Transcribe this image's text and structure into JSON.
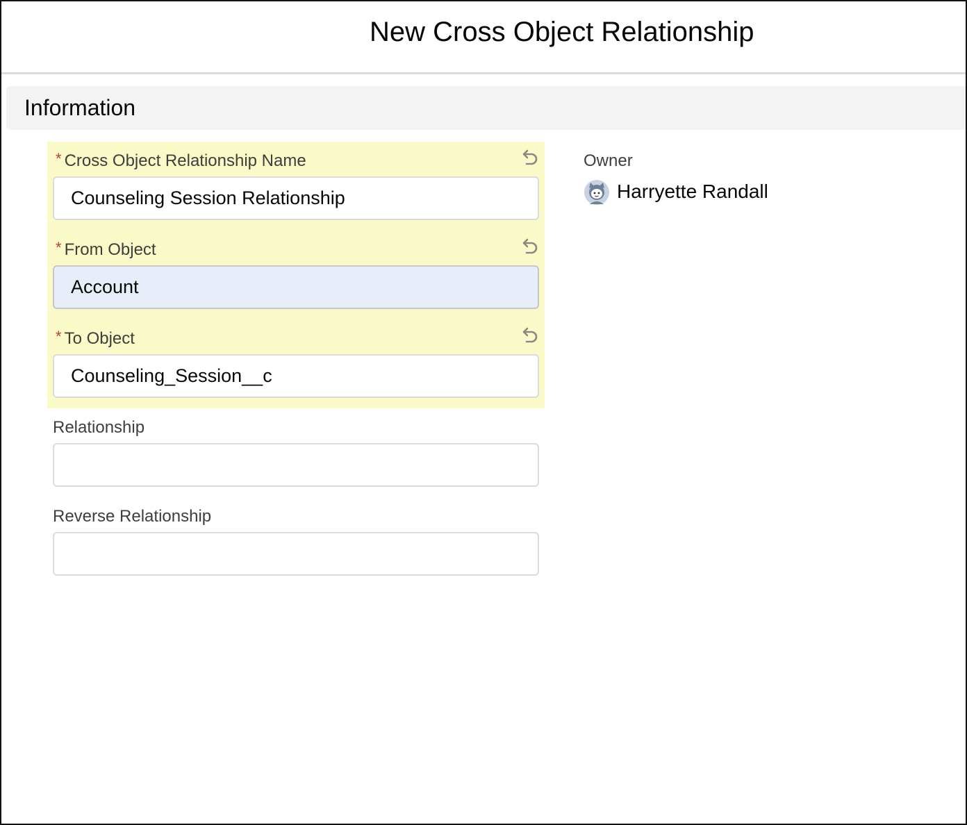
{
  "modal": {
    "title": "New Cross Object Relationship"
  },
  "section": {
    "title": "Information"
  },
  "fields": {
    "name": {
      "required_marker": "*",
      "label": "Cross Object Relationship Name",
      "value": "Counseling Session Relationship"
    },
    "from_object": {
      "required_marker": "*",
      "label": "From Object",
      "value": "Account"
    },
    "to_object": {
      "required_marker": "*",
      "label": "To Object",
      "value": "Counseling_Session__c"
    },
    "relationship": {
      "label": "Relationship",
      "value": ""
    },
    "reverse_relationship": {
      "label": "Reverse Relationship",
      "value": ""
    }
  },
  "owner": {
    "label": "Owner",
    "name": "Harryette Randall",
    "avatar_icon": "user-avatar-icon"
  },
  "icons": {
    "undo": "undo-icon"
  },
  "colors": {
    "changed_field_highlight": "#fafac8",
    "autofill_background": "#e8eef9",
    "required_star": "#c23934",
    "section_background": "#f3f3f3"
  }
}
